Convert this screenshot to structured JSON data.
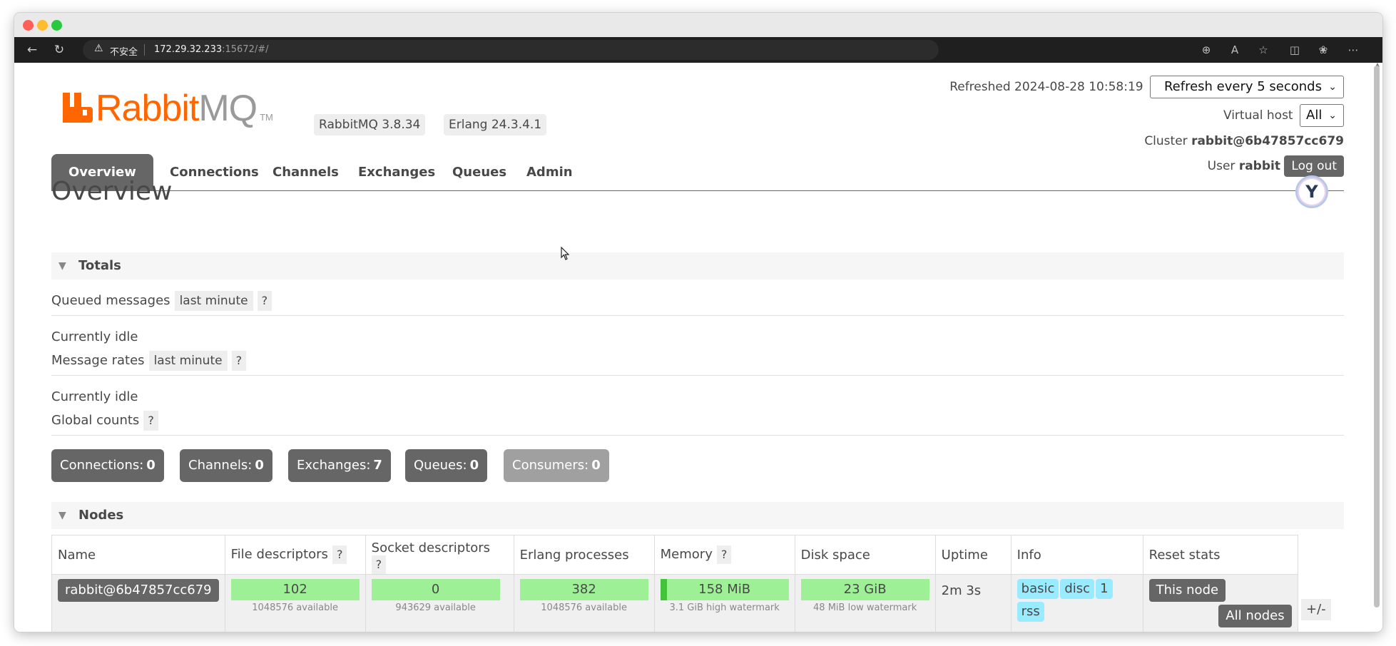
{
  "browser": {
    "security_label": "不安全",
    "host": "172.29.32.233",
    "path": ":15672/#/",
    "icons": [
      "back-icon",
      "reload-icon",
      "warning-icon",
      "zoom-icon",
      "read-aloud-icon",
      "favorite-icon",
      "split-screen-icon",
      "extensions-icon",
      "more-icon"
    ]
  },
  "header": {
    "logo_text_1": "Rabbit",
    "logo_text_2": "MQ",
    "logo_tm": "TM",
    "rabbitmq_version": "RabbitMQ 3.8.34",
    "erlang_version": "Erlang 24.3.4.1",
    "refreshed_label": "Refreshed 2024-08-28 10:58:19",
    "refresh_select": "Refresh every 5 seconds",
    "vhost_label": "Virtual host",
    "vhost_select": "All",
    "cluster_label": "Cluster",
    "cluster_name": "rabbit@6b47857cc679",
    "user_label": "User",
    "user_name": "rabbit",
    "logout_label": "Log out"
  },
  "tabs": [
    "Overview",
    "Connections",
    "Channels",
    "Exchanges",
    "Queues",
    "Admin"
  ],
  "active_tab": "Overview",
  "page_title": "Overview",
  "totals": {
    "header": "Totals",
    "queued_label": "Queued messages",
    "queued_range": "last minute",
    "queued_help": "?",
    "queued_idle": "Currently idle",
    "rates_label": "Message rates",
    "rates_range": "last minute",
    "rates_help": "?",
    "rates_idle": "Currently idle",
    "global_label": "Global counts",
    "global_help": "?",
    "counts": [
      {
        "label": "Connections:",
        "value": "0"
      },
      {
        "label": "Channels:",
        "value": "0"
      },
      {
        "label": "Exchanges:",
        "value": "7"
      },
      {
        "label": "Queues:",
        "value": "0"
      },
      {
        "label": "Consumers:",
        "value": "0"
      }
    ]
  },
  "nodes": {
    "header": "Nodes",
    "columns": {
      "name": "Name",
      "file_desc": "File descriptors",
      "socket_desc": "Socket descriptors",
      "erlang_proc": "Erlang processes",
      "memory": "Memory",
      "disk": "Disk space",
      "uptime": "Uptime",
      "info": "Info",
      "reset": "Reset stats",
      "help": "?"
    },
    "toggle_label": "+/-",
    "rows": [
      {
        "name": "rabbit@6b47857cc679",
        "file_desc": "102",
        "file_desc_sub": "1048576 available",
        "socket_desc": "0",
        "socket_desc_sub": "943629 available",
        "erlang_proc": "382",
        "erlang_proc_sub": "1048576 available",
        "memory": "158 MiB",
        "memory_sub": "3.1 GiB high watermark",
        "memory_used_fraction": 0.05,
        "disk": "23 GiB",
        "disk_sub": "48 MiB low watermark",
        "uptime": "2m 3s",
        "info_tags": [
          "basic",
          "disc",
          "1",
          "rss"
        ],
        "reset_this": "This node",
        "reset_all": "All nodes"
      }
    ]
  },
  "colors": {
    "brand_orange": "#ff6600",
    "tab_active": "#666666",
    "bar_green": "#9ef097",
    "info_tag": "#99ebff"
  }
}
